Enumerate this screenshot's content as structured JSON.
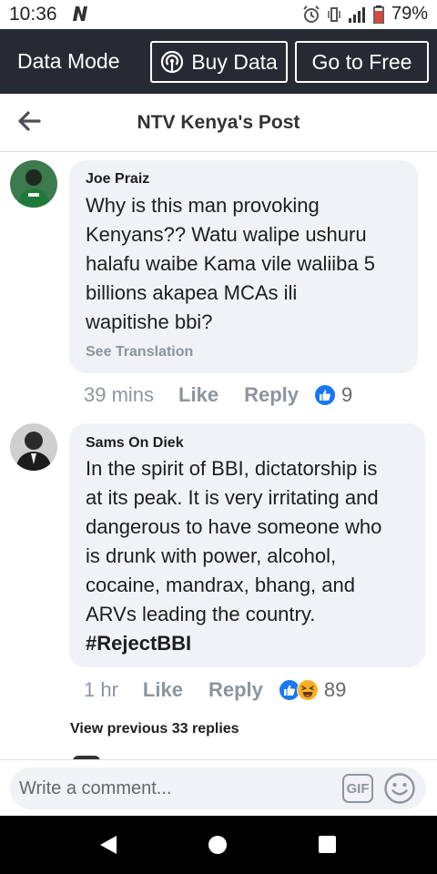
{
  "status_bar": {
    "time": "10:36",
    "battery_pct": "79%",
    "icons": [
      "n-notification-icon",
      "alarm-icon",
      "vibrate-icon",
      "signal-icon",
      "battery-icon"
    ]
  },
  "data_bar": {
    "mode_label": "Data Mode",
    "buy_label": "Buy Data",
    "free_label": "Go to Free",
    "bg_color": "#262b33"
  },
  "header": {
    "title": "NTV Kenya's Post"
  },
  "comments": [
    {
      "author": "Joe Praiz",
      "lines": [
        "Why is this man provoking",
        "Kenyans??  Watu walipe ushuru",
        "halafu waibe Kama vile waliiba 5",
        "billions akapea MCAs ili",
        "wapitishe bbi?"
      ],
      "see_translation": "See Translation",
      "time": "39 mins",
      "like": "Like",
      "reply": "Reply",
      "reactions": [
        "like"
      ],
      "reaction_count": "9"
    },
    {
      "author": "Sams On Diek",
      "lines": [
        "In the spirit of BBI, dictatorship is",
        "at its peak. It is very irritating and",
        "dangerous to have someone who",
        "is drunk with power, alcohol,",
        "cocaine, mandrax, bhang, and",
        "ARVs leading the country."
      ],
      "hashtag": "#RejectBBI",
      "time": "1 hr",
      "like": "Like",
      "reply": "Reply",
      "reactions": [
        "like",
        "haha"
      ],
      "reaction_count": "89"
    }
  ],
  "view_previous": "View previous 33 replies",
  "composer": {
    "placeholder": "Write a comment...",
    "gif_label": "GIF"
  },
  "colors": {
    "bubble": "#f0f2f5",
    "meta": "#8d949e",
    "like_blue": "#1877f2",
    "haha_yellow": "#f7b125"
  }
}
